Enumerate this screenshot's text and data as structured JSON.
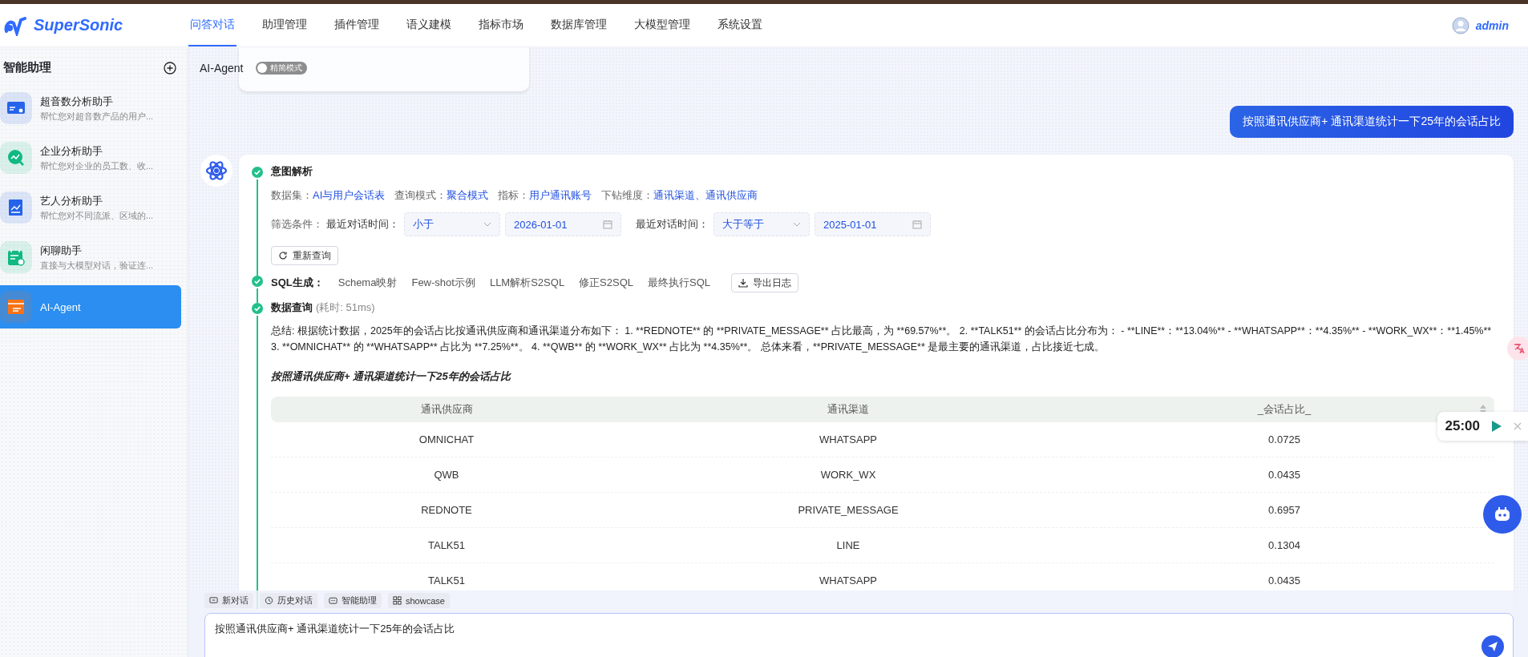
{
  "app": {
    "brand": "SuperSonic",
    "user": "admin"
  },
  "nav": [
    {
      "label": "问答对话",
      "selected": true
    },
    {
      "label": "助理管理",
      "selected": false
    },
    {
      "label": "插件管理",
      "selected": false
    },
    {
      "label": "语义建模",
      "selected": false
    },
    {
      "label": "指标市场",
      "selected": false
    },
    {
      "label": "数据库管理",
      "selected": false
    },
    {
      "label": "大模型管理",
      "selected": false
    },
    {
      "label": "系统设置",
      "selected": false
    }
  ],
  "sidebar": {
    "title": "智能助理",
    "items": [
      {
        "name": "超音数分析助手",
        "description": "帮忙您对超音数产品的用户...",
        "kind": "card",
        "color": "#2563eb",
        "selected": false
      },
      {
        "name": "企业分析助手",
        "description": "帮忙您对企业的员工数、收...",
        "kind": "search-chart",
        "color": "#10b981",
        "selected": false
      },
      {
        "name": "艺人分析助手",
        "description": "帮忙您对不同流派、区域的...",
        "kind": "chart",
        "color": "#2563eb",
        "selected": false
      },
      {
        "name": "闲聊助手",
        "description": "直接与大模型对话，验证连...",
        "kind": "calendar",
        "color": "#10b981",
        "selected": false
      },
      {
        "name": "AI-Agent",
        "kind": "window",
        "color": "#f97316",
        "selected": true
      }
    ]
  },
  "chat_header": {
    "title": "AI-Agent",
    "mode_toggle": {
      "label": "精简模式",
      "on": false
    }
  },
  "user_message": "按照通讯供应商+ 通讯渠道统计一下25年的会话占比",
  "steps": [
    {
      "kind": "intent",
      "title": "意图解析",
      "fields": [
        {
          "label": "数据集：",
          "value": "AI与用户会话表"
        },
        {
          "label": "查询模式：",
          "value": "聚合模式"
        },
        {
          "label": "指标：",
          "value": "用户通讯账号"
        },
        {
          "label": "下钻维度：",
          "value": "通讯渠道、通讯供应商"
        }
      ],
      "filter_label": "筛选条件：",
      "filters": [
        {
          "field": "最近对话时间：",
          "operator": "小于",
          "date": "2026-01-01"
        },
        {
          "field": "最近对话时间：",
          "operator": "大于等于",
          "date": "2025-01-01"
        }
      ],
      "retry_button": "重新查询"
    },
    {
      "kind": "sql",
      "title": "SQL生成：",
      "tabs": [
        "Schema映射",
        "Few-shot示例",
        "LLM解析S2SQL",
        "修正S2SQL",
        "最终执行SQL"
      ],
      "export_button": "导出日志"
    },
    {
      "kind": "query",
      "title": "数据查询",
      "timing": "(耗时: 51ms)",
      "summary": "总结: 根据统计数据，2025年的会话占比按通讯供应商和通讯渠道分布如下： 1. **REDNOTE** 的 **PRIVATE_MESSAGE** 占比最高，为 **69.57%**。 2. **TALK51** 的会话占比分布为： - **LINE**：**13.04%** - **WHATSAPP**：**4.35%** - **WORK_WX**：**1.45%** 3. **OMNICHAT** 的 **WHATSAPP** 占比为 **7.25%**。 4. **QWB** 的 **WORK_WX** 占比为 **4.35%**。 总体来看，**PRIVATE_MESSAGE** 是最主要的通讯渠道，占比接近七成。",
      "question": "按照通讯供应商+ 通讯渠道统计一下25年的会话占比",
      "table": {
        "columns": [
          {
            "label": "通讯供应商",
            "sortable": false
          },
          {
            "label": "通讯渠道",
            "sortable": false
          },
          {
            "label": "_会话占比_",
            "sortable": true
          }
        ],
        "rows": [
          [
            "OMNICHAT",
            "WHATSAPP",
            "0.0725"
          ],
          [
            "QWB",
            "WORK_WX",
            "0.0435"
          ],
          [
            "REDNOTE",
            "PRIVATE_MESSAGE",
            "0.6957"
          ],
          [
            "TALK51",
            "LINE",
            "0.1304"
          ],
          [
            "TALK51",
            "WHATSAPP",
            "0.0435"
          ]
        ]
      }
    }
  ],
  "toolbar": [
    {
      "label": "新对话",
      "kind": "chat"
    },
    {
      "label": "历史对话",
      "kind": "history"
    },
    {
      "label": "智能助理",
      "kind": "assistant"
    },
    {
      "label": "showcase",
      "kind": "grid"
    }
  ],
  "input": {
    "value": "按照通讯供应商+ 通讯渠道统计一下25年的会话占比"
  },
  "timer": {
    "time": "25:00"
  }
}
